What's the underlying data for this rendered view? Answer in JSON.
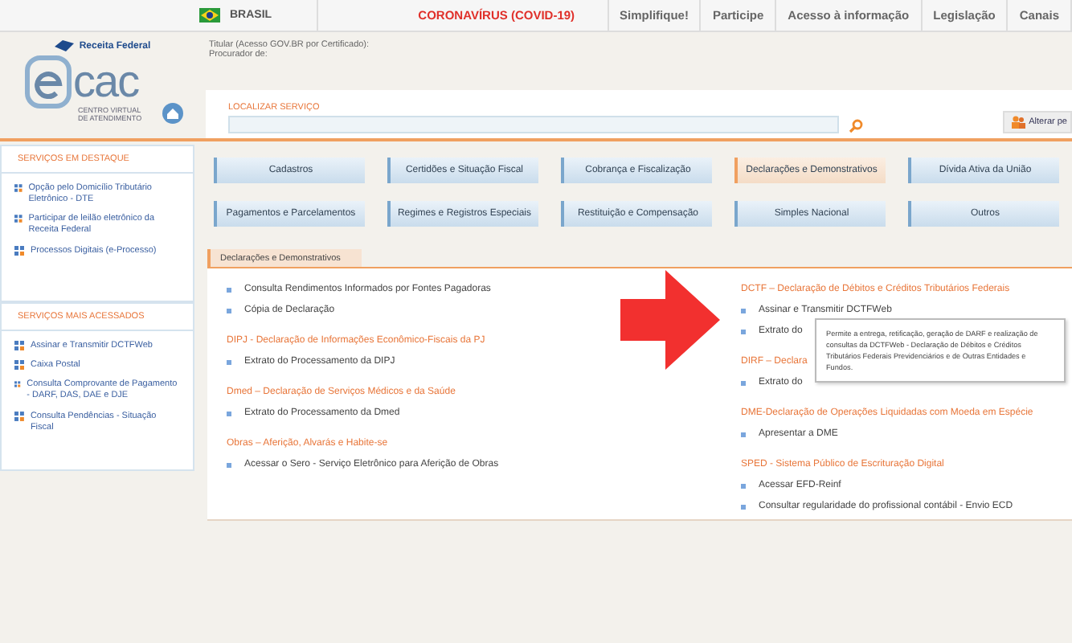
{
  "top_nav": {
    "country": "BRASIL",
    "items": [
      {
        "label": "CORONAVÍRUS (COVID-19)",
        "kind": "alert"
      },
      {
        "label": "Simplifique!",
        "kind": "normal"
      },
      {
        "label": "Participe",
        "kind": "normal"
      },
      {
        "label": "Acesso à informação",
        "kind": "normal"
      },
      {
        "label": "Legislação",
        "kind": "normal"
      },
      {
        "label": "Canais",
        "kind": "normal"
      }
    ]
  },
  "header": {
    "agency": "Receita Federal",
    "logo_text": "cac",
    "logo_sub": "CENTRO VIRTUAL DE ATENDIMENTO",
    "titular": "Titular (Acesso GOV.BR por Certificado):",
    "procurador": "Procurador de:"
  },
  "search": {
    "label": "LOCALIZAR SERVIÇO",
    "action": "Alterar pe"
  },
  "sidebar": [
    {
      "title": "SERVIÇOS EM DESTAQUE",
      "items": [
        "Opção pelo Domicílio Tributário Eletrônico - DTE",
        "Participar de leilão eletrônico da Receita Federal",
        "Processos Digitais (e-Processo)"
      ]
    },
    {
      "title": "SERVIÇOS MAIS ACESSADOS",
      "items": [
        "Assinar e Transmitir DCTFWeb",
        "Caixa Postal",
        "Consulta Comprovante de Pagamento - DARF, DAS, DAE e DJE",
        "Consulta Pendências - Situação Fiscal"
      ]
    }
  ],
  "categories": [
    {
      "label": "Cadastros",
      "selected": false
    },
    {
      "label": "Certidões e Situação Fiscal",
      "selected": false
    },
    {
      "label": "Cobrança e Fiscalização",
      "selected": false
    },
    {
      "label": "Declarações e Demonstrativos",
      "selected": true
    },
    {
      "label": "Dívida Ativa da União",
      "selected": false
    },
    {
      "label": "Pagamentos e Parcelamentos",
      "selected": false
    },
    {
      "label": "Regimes e Registros Especiais",
      "selected": false
    },
    {
      "label": "Restituição e Compensação",
      "selected": false
    },
    {
      "label": "Simples Nacional",
      "selected": false
    },
    {
      "label": "Outros",
      "selected": false
    }
  ],
  "panel": {
    "tab": "Declarações e Demonstrativos",
    "left": [
      {
        "items": [
          "Consulta Rendimentos Informados por Fontes Pagadoras",
          "Cópia de Declaração"
        ]
      },
      {
        "heading": "DIPJ - Declaração de Informações Econômico-Fiscais da PJ",
        "items": [
          "Extrato do Processamento da DIPJ"
        ]
      },
      {
        "heading": "Dmed – Declaração de Serviços Médicos e da Saúde",
        "items": [
          "Extrato do Processamento da Dmed"
        ]
      },
      {
        "heading": "Obras – Aferição, Alvarás e Habite-se",
        "items": [
          "Acessar o Sero - Serviço Eletrônico para Aferição de Obras"
        ]
      }
    ],
    "right": [
      {
        "heading": "DCTF – Declaração de Débitos e Créditos Tributários Federais",
        "items": [
          "Assinar e Transmitir DCTFWeb",
          "Extrato do"
        ]
      },
      {
        "heading": "DIRF – Declara",
        "items": [
          "Extrato do"
        ]
      },
      {
        "heading": "DME-Declaração de Operações Liquidadas com Moeda em Espécie",
        "items": [
          "Apresentar a DME"
        ]
      },
      {
        "heading": "SPED - Sistema Público de Escrituração Digital",
        "items": [
          "Acessar EFD-Reinf",
          "Consultar regularidade do profissional contábil - Envio ECD"
        ]
      }
    ]
  },
  "tooltip": "Permite a entrega, retificação, geração de DARF e realização de consultas da DCTFWeb - Declaração de Débitos e Créditos Tributários Federais Previdenciários e de Outras Entidades e Fundos."
}
